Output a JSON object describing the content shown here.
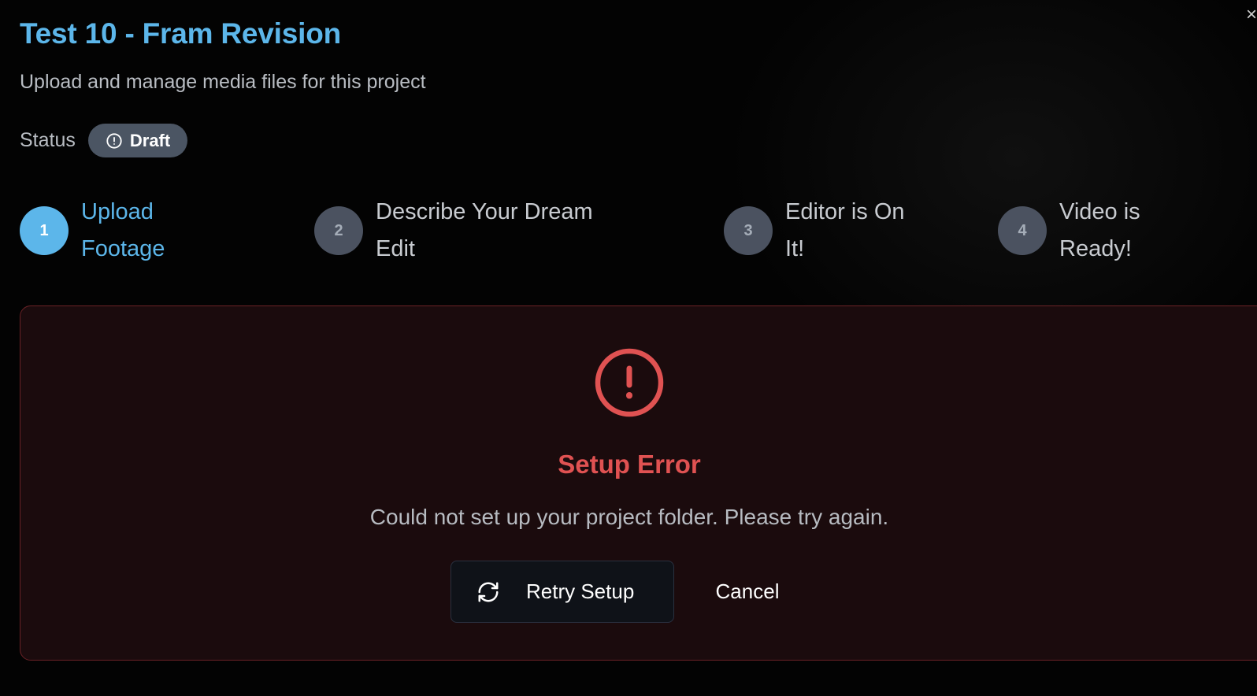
{
  "dialog": {
    "title": "Test 10 - Fram Revision",
    "subtitle": "Upload and manage media files for this project",
    "close_label": "×",
    "status": {
      "label": "Status",
      "badge": "Draft",
      "badge_icon": "alert-circle-icon"
    }
  },
  "steps": [
    {
      "number": "1",
      "line1": "Upload",
      "line2": "Footage",
      "active": true
    },
    {
      "number": "2",
      "line1": "Describe Your Dream",
      "line2": "Edit",
      "active": false
    },
    {
      "number": "3",
      "line1": "Editor is On",
      "line2": "It!",
      "active": false
    },
    {
      "number": "4",
      "line1": "Video is",
      "line2": "Ready!",
      "active": false
    }
  ],
  "error": {
    "icon": "alert-circle-icon",
    "title": "Setup Error",
    "message": "Could not set up your project folder. Please try again.",
    "retry_label": "Retry Setup",
    "retry_icon": "refresh-icon",
    "cancel_label": "Cancel"
  },
  "colors": {
    "accent": "#5cb6ea",
    "error": "#e05252",
    "badge_bg": "#4b5563",
    "panel_bg": "#1b0b0d"
  }
}
